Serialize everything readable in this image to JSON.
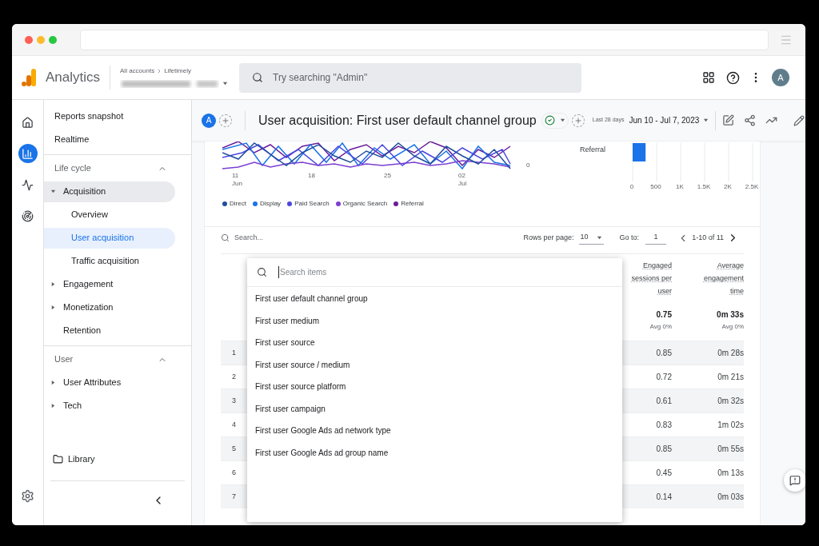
{
  "header": {
    "product": "Analytics",
    "breadcrumb": [
      "All accounts",
      "Lifetimely"
    ],
    "search_placeholder": "Try searching \"Admin\"",
    "avatar": "A"
  },
  "rail": [
    {
      "kind": "home",
      "selected": false
    },
    {
      "kind": "reports",
      "selected": true
    },
    {
      "kind": "explore",
      "selected": false
    },
    {
      "kind": "advertising",
      "selected": false
    }
  ],
  "nav": {
    "top": [
      {
        "label": "Reports snapshot"
      },
      {
        "label": "Realtime"
      }
    ],
    "sections": [
      {
        "title": "Life cycle",
        "expanded": true,
        "items": [
          {
            "label": "Acquisition",
            "expanded": true,
            "children": [
              {
                "label": "Overview",
                "selected": false
              },
              {
                "label": "User acquisition",
                "selected": true
              },
              {
                "label": "Traffic acquisition",
                "selected": false
              }
            ]
          },
          {
            "label": "Engagement",
            "expanded": false
          },
          {
            "label": "Monetization",
            "expanded": false
          },
          {
            "label": "Retention"
          }
        ]
      },
      {
        "title": "User",
        "expanded": true,
        "items": [
          {
            "label": "User Attributes",
            "expanded": false
          },
          {
            "label": "Tech",
            "expanded": false
          }
        ]
      }
    ],
    "library": "Library"
  },
  "report": {
    "comparison_avatar": "A",
    "title": "User acquisition: First user default channel group",
    "date_label": "Last 28 days",
    "date_range": "Jun 10 - Jul 7, 2023"
  },
  "line_chart": {
    "x_labels": [
      {
        "day": "11",
        "month": "Jun"
      },
      {
        "day": "18"
      },
      {
        "day": "25"
      },
      {
        "day": "02",
        "month": "Jul"
      }
    ],
    "y_label": "0",
    "legend": [
      {
        "label": "Direct",
        "color": "#1f4e9c"
      },
      {
        "label": "Display",
        "color": "#1a73e8"
      },
      {
        "label": "Paid Search",
        "color": "#4b48e0"
      },
      {
        "label": "Organic Search",
        "color": "#7b3fd1"
      },
      {
        "label": "Referral",
        "color": "#6a1b9a"
      }
    ]
  },
  "bar_chart": {
    "chart_data": {
      "type": "bar",
      "orientation": "horizontal",
      "categories": [
        "Referral"
      ],
      "values": [
        270
      ],
      "xlim": [
        0,
        2500
      ],
      "xticks": [
        0,
        500,
        {
          "value": 1000,
          "label": "1K"
        },
        {
          "value": 1500,
          "label": "1.5K"
        },
        {
          "value": 2000,
          "label": "2K"
        },
        {
          "value": 2500,
          "label": "2.5K"
        }
      ],
      "grid": true,
      "color": "#1a73e8"
    }
  },
  "table": {
    "search_placeholder": "Search...",
    "rows_per_page_label": "Rows per page:",
    "rows_per_page": "10",
    "goto_label": "Go to:",
    "goto": "1",
    "page_info": "1-10 of 11",
    "columns": [
      {
        "label": "Engaged sessions per user"
      },
      {
        "label": "Average engagement time"
      }
    ],
    "totals": [
      {
        "value": "0.75",
        "note": "Avg 0%"
      },
      {
        "value": "0m 33s",
        "note": "Avg 0%"
      }
    ],
    "rows": [
      {
        "index": "1",
        "cells": [
          "0.85",
          "0m 28s"
        ]
      },
      {
        "index": "2",
        "cells": [
          "0.72",
          "0m 21s"
        ]
      },
      {
        "index": "3",
        "cells": [
          "0.61",
          "0m 32s"
        ]
      },
      {
        "index": "4",
        "cells": [
          "0.83",
          "1m 02s"
        ]
      },
      {
        "index": "5",
        "cells": [
          "0.85",
          "0m 55s"
        ]
      },
      {
        "index": "6",
        "cells": [
          "0.45",
          "0m 13s"
        ]
      },
      {
        "index": "7",
        "cells": [
          "0.14",
          "0m 03s"
        ]
      }
    ]
  },
  "dimension_menu": {
    "placeholder": "Search items",
    "items": [
      "First user default channel group",
      "First user medium",
      "First user source",
      "First user source / medium",
      "First user source platform",
      "First user campaign",
      "First user Google Ads ad network type",
      "First user Google Ads ad group name"
    ]
  }
}
